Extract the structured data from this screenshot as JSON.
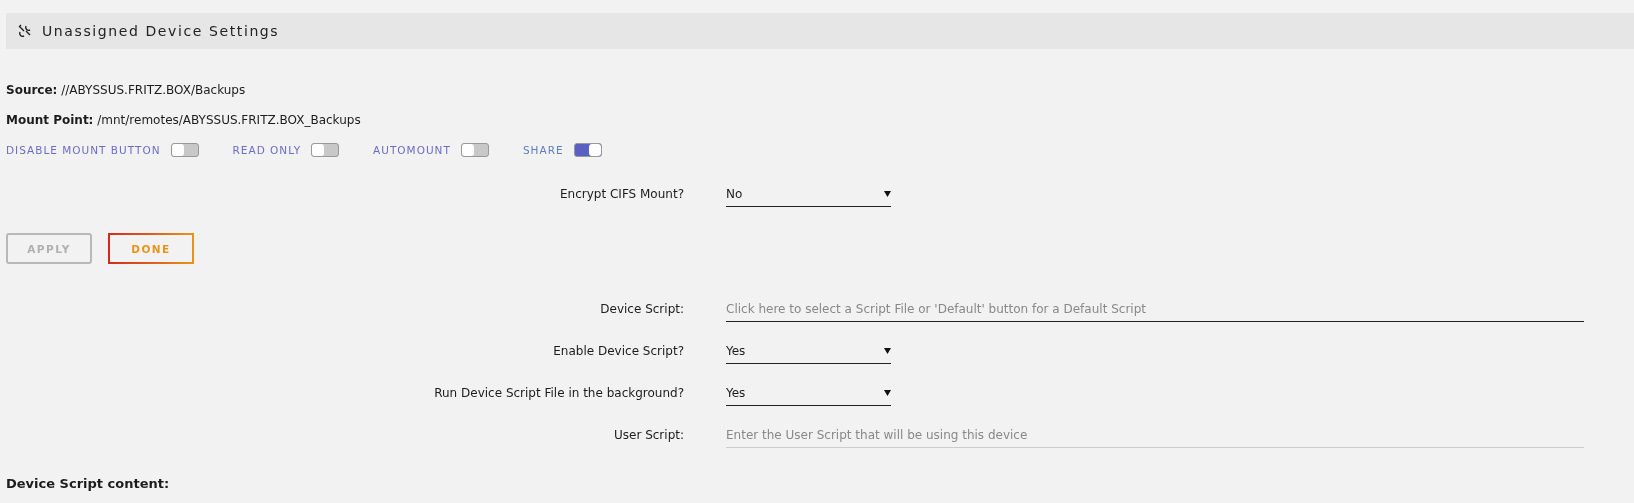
{
  "header": {
    "title": "Unassigned Device Settings"
  },
  "info": [
    {
      "label": "Source:",
      "value": "//ABYSSUS.FRITZ.BOX/Backups"
    },
    {
      "label": "Mount Point:",
      "value": "/mnt/remotes/ABYSSUS.FRITZ.BOX_Backups"
    }
  ],
  "switches": [
    {
      "label": "DISABLE MOUNT BUTTON",
      "on": false
    },
    {
      "label": "READ ONLY",
      "on": false
    },
    {
      "label": "AUTOMOUNT",
      "on": false
    },
    {
      "label": "SHARE",
      "on": true
    }
  ],
  "encrypt": {
    "label": "Encrypt CIFS Mount?",
    "kind": "select",
    "value": "No"
  },
  "buttons": [
    {
      "label": "APPLY",
      "disabled": true
    },
    {
      "label": "DONE",
      "disabled": false
    }
  ],
  "script_fields": [
    {
      "label": "Device Script:",
      "kind": "input",
      "placeholder": "Click here to select a Script File or 'Default' button for a Default Script",
      "emphasis": true
    },
    {
      "label": "Enable Device Script?",
      "kind": "select",
      "value": "Yes"
    },
    {
      "label": "Run Device Script File in the background?",
      "kind": "select",
      "value": "Yes"
    },
    {
      "label": "User Script:",
      "kind": "input",
      "placeholder": "Enter the User Script that will be using this device",
      "emphasis": false
    }
  ],
  "content_heading": "Device Script content:"
}
